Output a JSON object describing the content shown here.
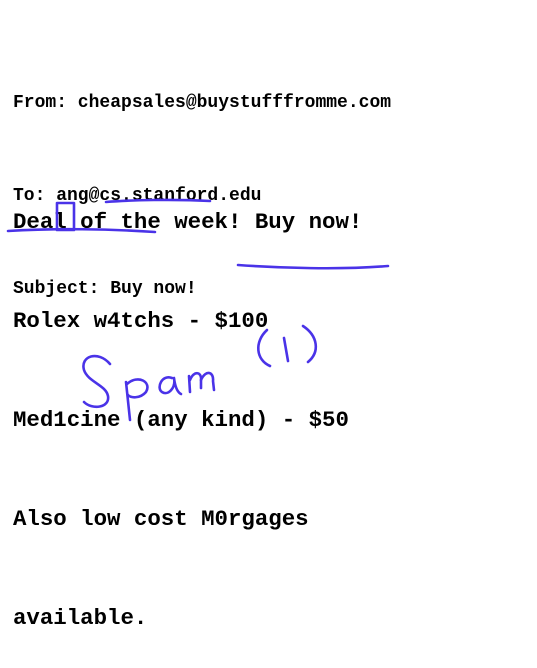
{
  "email": {
    "from": "From: cheapsales@buystufffromme.com",
    "to": "To: ang@cs.stanford.edu",
    "subject": "Subject: Buy now!",
    "body_lines": [
      "Deal of the week! Buy now!",
      "Rolex w4tchs - $100",
      "Med1cine (any kind) - $50",
      "Also low cost M0rgages",
      "available."
    ]
  },
  "annotations": {
    "ink_color": "#4a33e8",
    "handwritten_label": "Spam (1)"
  }
}
